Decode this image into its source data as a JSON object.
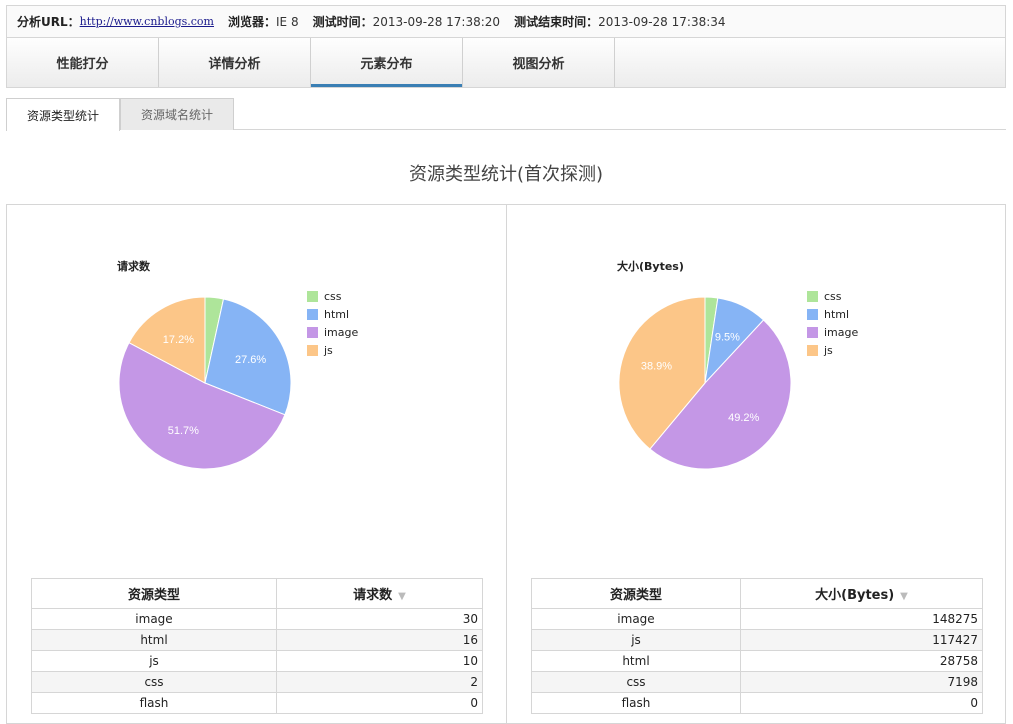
{
  "info": {
    "url_label": "分析URL：",
    "url": "http://www.cnblogs.com",
    "browser_label": "浏览器：",
    "browser": "IE 8",
    "start_label": "测试时间：",
    "start": "2013-09-28 17:38:20",
    "end_label": "测试结束时间：",
    "end": "2013-09-28 17:38:34"
  },
  "tabs": [
    "性能打分",
    "详情分析",
    "元素分布",
    "视图分析"
  ],
  "subtabs": [
    "资源类型统计",
    "资源域名统计"
  ],
  "section_title": "资源类型统计(首次探测)",
  "colors": {
    "css": "#aee59a",
    "html": "#86b4f5",
    "image": "#c497e6",
    "js": "#fcc688"
  },
  "chart_data": [
    {
      "type": "pie",
      "title": "请求数",
      "categories": [
        "css",
        "html",
        "image",
        "js"
      ],
      "values": [
        2,
        16,
        30,
        10
      ],
      "labels": [
        "",
        "27.6%",
        "51.7%",
        "17.2%"
      ]
    },
    {
      "type": "pie",
      "title": "大小(Bytes)",
      "categories": [
        "css",
        "html",
        "image",
        "js"
      ],
      "values": [
        7198,
        28758,
        148275,
        117427
      ],
      "labels": [
        "",
        "9.5%",
        "49.2%",
        "38.9%"
      ]
    }
  ],
  "left_table": {
    "headers": [
      "资源类型",
      "请求数"
    ],
    "sort_icon": "▼",
    "rows": [
      [
        "image",
        "30"
      ],
      [
        "html",
        "16"
      ],
      [
        "js",
        "10"
      ],
      [
        "css",
        "2"
      ],
      [
        "flash",
        "0"
      ]
    ]
  },
  "right_table": {
    "headers": [
      "资源类型",
      "大小(Bytes)"
    ],
    "sort_icon": "▼",
    "rows": [
      [
        "image",
        "148275"
      ],
      [
        "js",
        "117427"
      ],
      [
        "html",
        "28758"
      ],
      [
        "css",
        "7198"
      ],
      [
        "flash",
        "0"
      ]
    ]
  }
}
